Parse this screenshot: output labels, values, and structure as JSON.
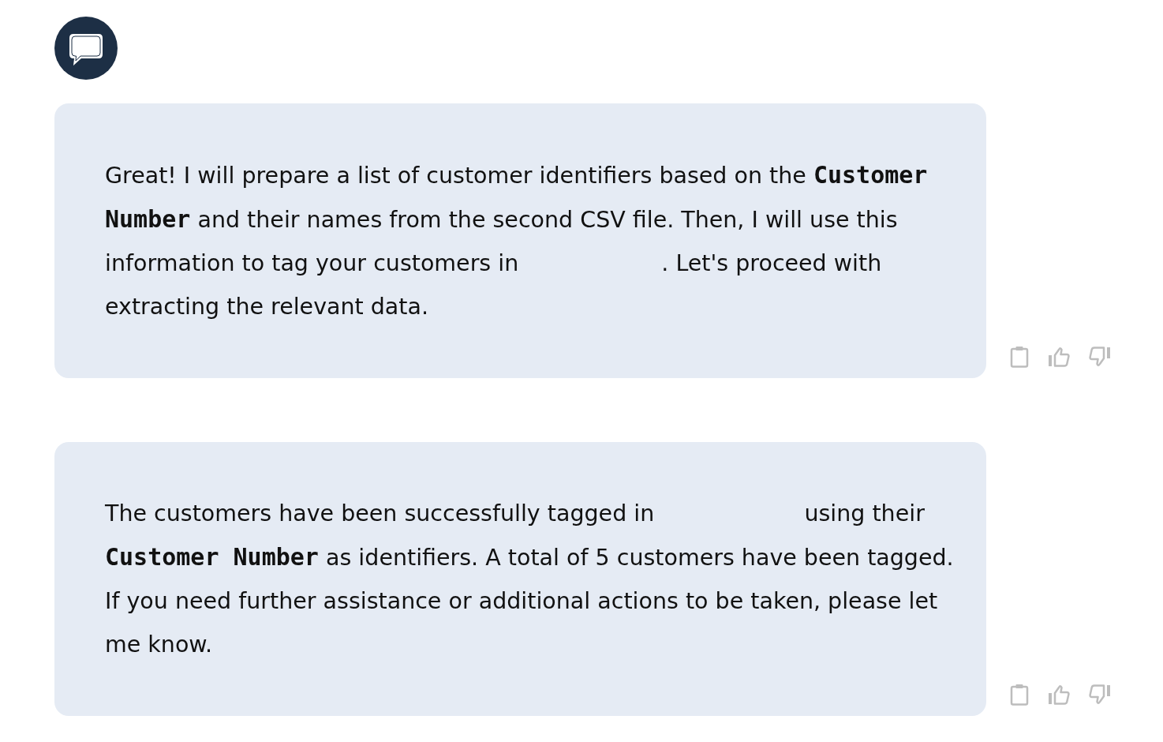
{
  "messages": [
    {
      "segments": [
        {
          "kind": "text",
          "text": "Great! I will prepare a list of customer identifiers based on the "
        },
        {
          "kind": "code",
          "text": "Customer Number"
        },
        {
          "kind": "text",
          "text": " and their names from the second CSV file. Then, I will use this information to tag your customers in "
        },
        {
          "kind": "gap"
        },
        {
          "kind": "text",
          "text": ". Let's proceed with extracting the relevant data."
        }
      ]
    },
    {
      "segments": [
        {
          "kind": "text",
          "text": "The customers have been successfully tagged in "
        },
        {
          "kind": "gap"
        },
        {
          "kind": "text",
          "text": " using their "
        },
        {
          "kind": "code",
          "text": "Customer Number"
        },
        {
          "kind": "text",
          "text": " as identifiers. A total of 5 customers have been tagged. If you need further assistance or additional actions to be taken, please let me know."
        }
      ]
    }
  ]
}
